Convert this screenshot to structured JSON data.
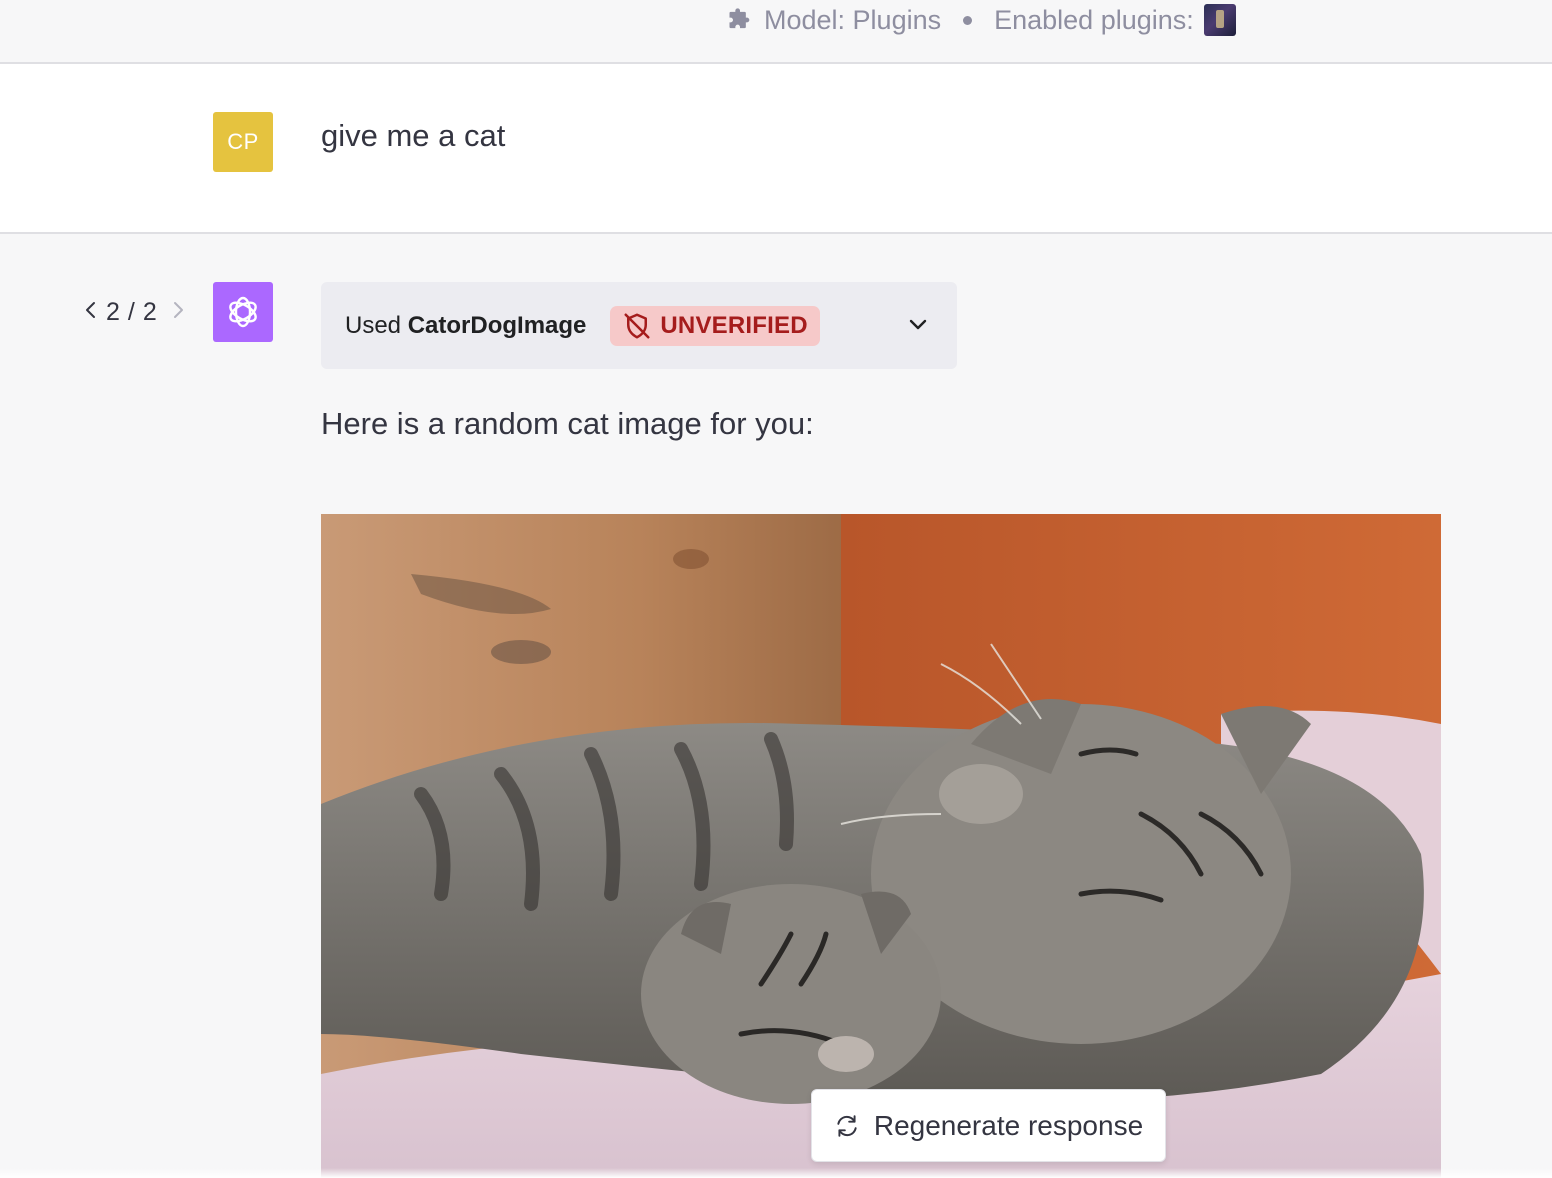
{
  "header": {
    "model_label": "Model: Plugins",
    "enabled_plugins_label": "Enabled plugins:",
    "puzzle_icon": "puzzle-icon",
    "plugin_thumbnail": "plugin-thumbnail"
  },
  "user_message": {
    "avatar_initials": "CP",
    "avatar_color": "#e5c33f",
    "text": "give me a cat"
  },
  "assistant_message": {
    "pager": {
      "prev_icon": "chevron-left-icon",
      "current": "2",
      "separator": "/",
      "total": "2",
      "next_icon": "chevron-right-icon"
    },
    "avatar_color": "#ab68ff",
    "avatar_icon": "openai-logo-icon",
    "plugin_used": {
      "prefix": "Used",
      "name": "CatorDogImage",
      "badge": "UNVERIFIED",
      "badge_icon": "shield-off-icon",
      "expand_icon": "chevron-down-icon"
    },
    "text": "Here is a random cat image for you:",
    "image": "two-sleeping-tabby-kittens-photo"
  },
  "actions": {
    "regenerate_label": "Regenerate response",
    "regenerate_icon": "refresh-icon"
  },
  "colors": {
    "badge_bg": "#f6c9c9",
    "badge_text": "#a51c1c",
    "page_bg": "#f7f7f8"
  }
}
